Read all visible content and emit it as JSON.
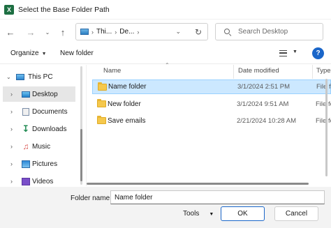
{
  "window": {
    "title": "Select the Base Folder Path",
    "app_icon": "X"
  },
  "nav": {
    "back_icon": "arrow-left",
    "forward_icon": "arrow-right",
    "recent_icon": "chevron-down",
    "up_icon": "arrow-up",
    "breadcrumbs": [
      "Thi...",
      "De..."
    ],
    "search_placeholder": "Search Desktop"
  },
  "commands": {
    "organize": "Organize",
    "new_folder": "New folder"
  },
  "sidebar": {
    "items": [
      {
        "label": "This PC",
        "icon": "computer-icon",
        "expanded": true
      },
      {
        "label": "Desktop",
        "icon": "desktop-icon",
        "selected": true
      },
      {
        "label": "Documents",
        "icon": "documents-icon"
      },
      {
        "label": "Downloads",
        "icon": "downloads-icon"
      },
      {
        "label": "Music",
        "icon": "music-icon"
      },
      {
        "label": "Pictures",
        "icon": "pictures-icon"
      },
      {
        "label": "Videos",
        "icon": "videos-icon"
      }
    ]
  },
  "list": {
    "columns": [
      "Name",
      "Date modified",
      "Type"
    ],
    "rows": [
      {
        "name": "Name folder",
        "date": "3/1/2024 2:51 PM",
        "type": "File fo",
        "selected": true
      },
      {
        "name": "New folder",
        "date": "3/1/2024 9:51 AM",
        "type": "File fo"
      },
      {
        "name": "Save emails",
        "date": "2/21/2024 10:28 AM",
        "type": "File fo"
      }
    ]
  },
  "footer": {
    "folder_name_label": "Folder name:",
    "folder_name_value": "Name folder",
    "tools": "Tools",
    "ok": "OK",
    "cancel": "Cancel"
  },
  "colors": {
    "accent": "#1a66c9",
    "selection": "#cce8ff",
    "excel": "#1d6f42"
  }
}
